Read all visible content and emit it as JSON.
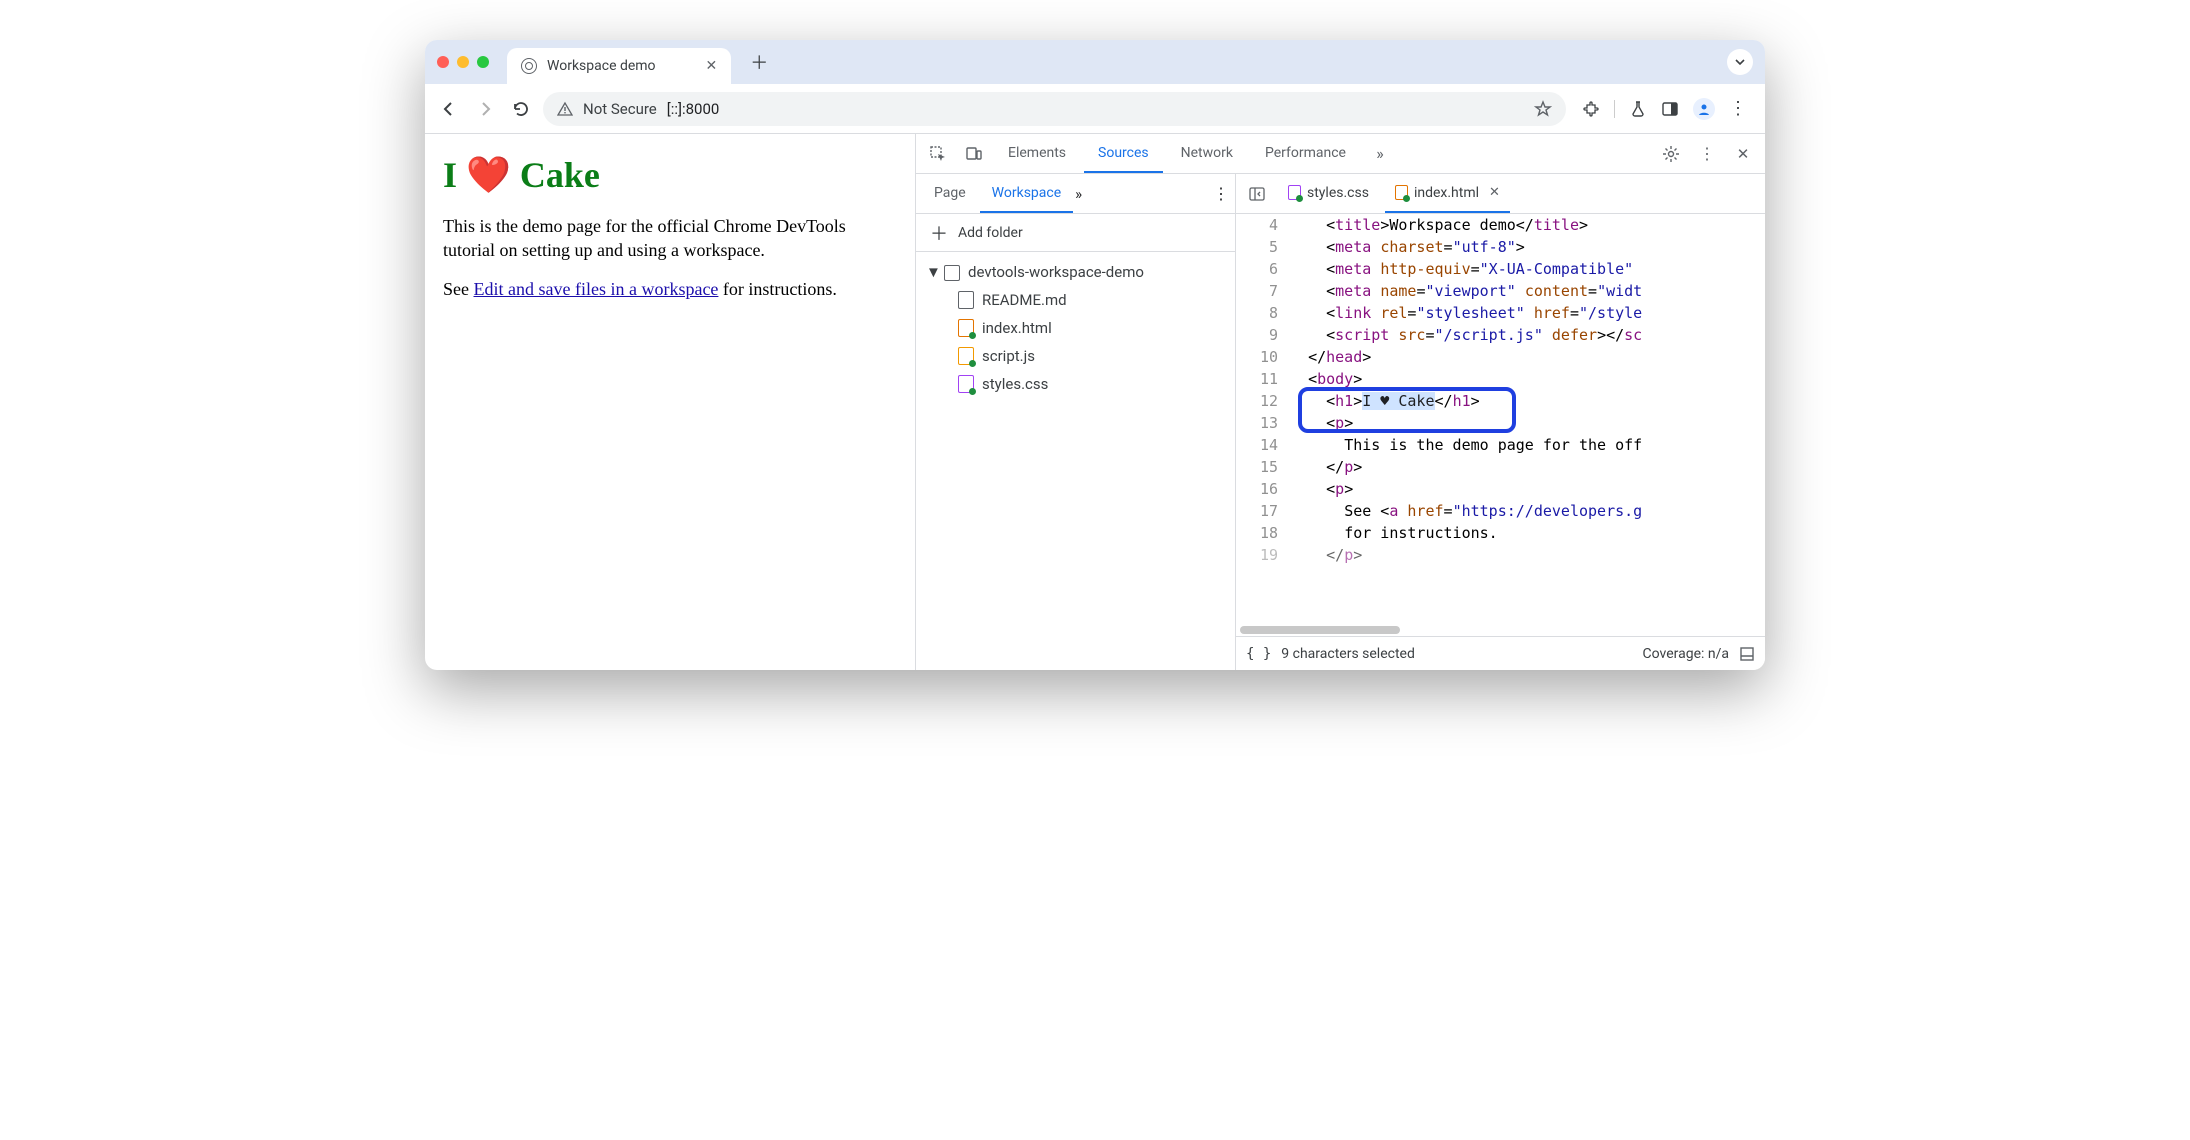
{
  "browser": {
    "tab_title": "Workspace demo",
    "not_secure_label": "Not Secure",
    "address": "[::]:8000"
  },
  "page": {
    "h1_prefix": "I ",
    "h1_heart": "❤️",
    "h1_suffix": " Cake",
    "para1": "This is the demo page for the official Chrome DevTools tutorial on setting up and using a workspace.",
    "para2_prefix": "See ",
    "para2_link": "Edit and save files in a workspace",
    "para2_suffix": " for instructions."
  },
  "devtools": {
    "tabs": {
      "elements": "Elements",
      "sources": "Sources",
      "network": "Network",
      "performance": "Performance"
    },
    "sources_nav": {
      "page": "Page",
      "workspace": "Workspace",
      "add_folder": "Add folder",
      "folder": "devtools-workspace-demo",
      "files": {
        "readme": "README.md",
        "index": "index.html",
        "script": "script.js",
        "styles": "styles.css"
      }
    },
    "editor_tabs": {
      "styles": "styles.css",
      "index": "index.html"
    },
    "code_lines": {
      "4": "    <title>Workspace demo</title>",
      "5": "    <meta charset=\"utf-8\">",
      "6": "    <meta http-equiv=\"X-UA-Compatible\" ",
      "7": "    <meta name=\"viewport\" content=\"widt",
      "8": "    <link rel=\"stylesheet\" href=\"/style",
      "9": "    <script src=\"/script.js\" defer></sc",
      "10": "  </head>",
      "11": "  <body>",
      "12": "    <h1>I ♥ Cake</h1>",
      "13": "    <p>",
      "14": "      This is the demo page for the off",
      "15": "    </p>",
      "16": "    <p>",
      "17": "      See <a href=\"https://developers.g",
      "18": "      for instructions.",
      "19": "    </p>"
    },
    "status": {
      "selection": "9 characters selected",
      "coverage": "Coverage: n/a"
    }
  }
}
